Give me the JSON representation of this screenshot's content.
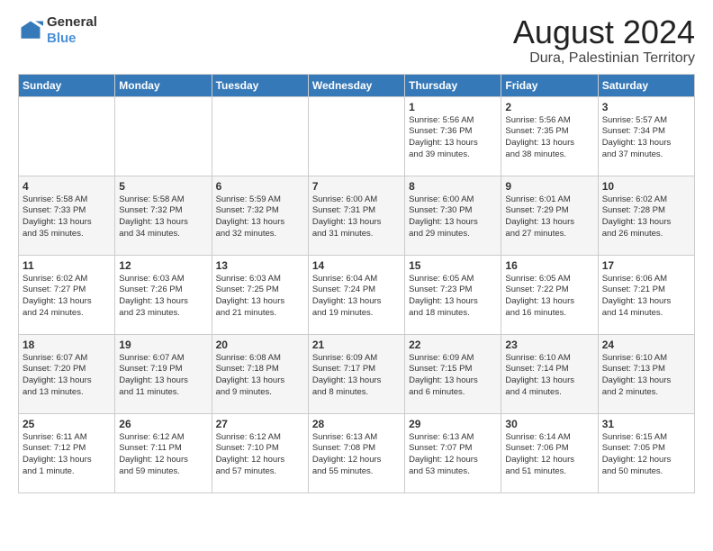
{
  "header": {
    "logo_general": "General",
    "logo_blue": "Blue",
    "main_title": "August 2024",
    "subtitle": "Dura, Palestinian Territory"
  },
  "weekdays": [
    "Sunday",
    "Monday",
    "Tuesday",
    "Wednesday",
    "Thursday",
    "Friday",
    "Saturday"
  ],
  "weeks": [
    [
      {
        "num": "",
        "info": ""
      },
      {
        "num": "",
        "info": ""
      },
      {
        "num": "",
        "info": ""
      },
      {
        "num": "",
        "info": ""
      },
      {
        "num": "1",
        "info": "Sunrise: 5:56 AM\nSunset: 7:36 PM\nDaylight: 13 hours\nand 39 minutes."
      },
      {
        "num": "2",
        "info": "Sunrise: 5:56 AM\nSunset: 7:35 PM\nDaylight: 13 hours\nand 38 minutes."
      },
      {
        "num": "3",
        "info": "Sunrise: 5:57 AM\nSunset: 7:34 PM\nDaylight: 13 hours\nand 37 minutes."
      }
    ],
    [
      {
        "num": "4",
        "info": "Sunrise: 5:58 AM\nSunset: 7:33 PM\nDaylight: 13 hours\nand 35 minutes."
      },
      {
        "num": "5",
        "info": "Sunrise: 5:58 AM\nSunset: 7:32 PM\nDaylight: 13 hours\nand 34 minutes."
      },
      {
        "num": "6",
        "info": "Sunrise: 5:59 AM\nSunset: 7:32 PM\nDaylight: 13 hours\nand 32 minutes."
      },
      {
        "num": "7",
        "info": "Sunrise: 6:00 AM\nSunset: 7:31 PM\nDaylight: 13 hours\nand 31 minutes."
      },
      {
        "num": "8",
        "info": "Sunrise: 6:00 AM\nSunset: 7:30 PM\nDaylight: 13 hours\nand 29 minutes."
      },
      {
        "num": "9",
        "info": "Sunrise: 6:01 AM\nSunset: 7:29 PM\nDaylight: 13 hours\nand 27 minutes."
      },
      {
        "num": "10",
        "info": "Sunrise: 6:02 AM\nSunset: 7:28 PM\nDaylight: 13 hours\nand 26 minutes."
      }
    ],
    [
      {
        "num": "11",
        "info": "Sunrise: 6:02 AM\nSunset: 7:27 PM\nDaylight: 13 hours\nand 24 minutes."
      },
      {
        "num": "12",
        "info": "Sunrise: 6:03 AM\nSunset: 7:26 PM\nDaylight: 13 hours\nand 23 minutes."
      },
      {
        "num": "13",
        "info": "Sunrise: 6:03 AM\nSunset: 7:25 PM\nDaylight: 13 hours\nand 21 minutes."
      },
      {
        "num": "14",
        "info": "Sunrise: 6:04 AM\nSunset: 7:24 PM\nDaylight: 13 hours\nand 19 minutes."
      },
      {
        "num": "15",
        "info": "Sunrise: 6:05 AM\nSunset: 7:23 PM\nDaylight: 13 hours\nand 18 minutes."
      },
      {
        "num": "16",
        "info": "Sunrise: 6:05 AM\nSunset: 7:22 PM\nDaylight: 13 hours\nand 16 minutes."
      },
      {
        "num": "17",
        "info": "Sunrise: 6:06 AM\nSunset: 7:21 PM\nDaylight: 13 hours\nand 14 minutes."
      }
    ],
    [
      {
        "num": "18",
        "info": "Sunrise: 6:07 AM\nSunset: 7:20 PM\nDaylight: 13 hours\nand 13 minutes."
      },
      {
        "num": "19",
        "info": "Sunrise: 6:07 AM\nSunset: 7:19 PM\nDaylight: 13 hours\nand 11 minutes."
      },
      {
        "num": "20",
        "info": "Sunrise: 6:08 AM\nSunset: 7:18 PM\nDaylight: 13 hours\nand 9 minutes."
      },
      {
        "num": "21",
        "info": "Sunrise: 6:09 AM\nSunset: 7:17 PM\nDaylight: 13 hours\nand 8 minutes."
      },
      {
        "num": "22",
        "info": "Sunrise: 6:09 AM\nSunset: 7:15 PM\nDaylight: 13 hours\nand 6 minutes."
      },
      {
        "num": "23",
        "info": "Sunrise: 6:10 AM\nSunset: 7:14 PM\nDaylight: 13 hours\nand 4 minutes."
      },
      {
        "num": "24",
        "info": "Sunrise: 6:10 AM\nSunset: 7:13 PM\nDaylight: 13 hours\nand 2 minutes."
      }
    ],
    [
      {
        "num": "25",
        "info": "Sunrise: 6:11 AM\nSunset: 7:12 PM\nDaylight: 13 hours\nand 1 minute."
      },
      {
        "num": "26",
        "info": "Sunrise: 6:12 AM\nSunset: 7:11 PM\nDaylight: 12 hours\nand 59 minutes."
      },
      {
        "num": "27",
        "info": "Sunrise: 6:12 AM\nSunset: 7:10 PM\nDaylight: 12 hours\nand 57 minutes."
      },
      {
        "num": "28",
        "info": "Sunrise: 6:13 AM\nSunset: 7:08 PM\nDaylight: 12 hours\nand 55 minutes."
      },
      {
        "num": "29",
        "info": "Sunrise: 6:13 AM\nSunset: 7:07 PM\nDaylight: 12 hours\nand 53 minutes."
      },
      {
        "num": "30",
        "info": "Sunrise: 6:14 AM\nSunset: 7:06 PM\nDaylight: 12 hours\nand 51 minutes."
      },
      {
        "num": "31",
        "info": "Sunrise: 6:15 AM\nSunset: 7:05 PM\nDaylight: 12 hours\nand 50 minutes."
      }
    ]
  ]
}
